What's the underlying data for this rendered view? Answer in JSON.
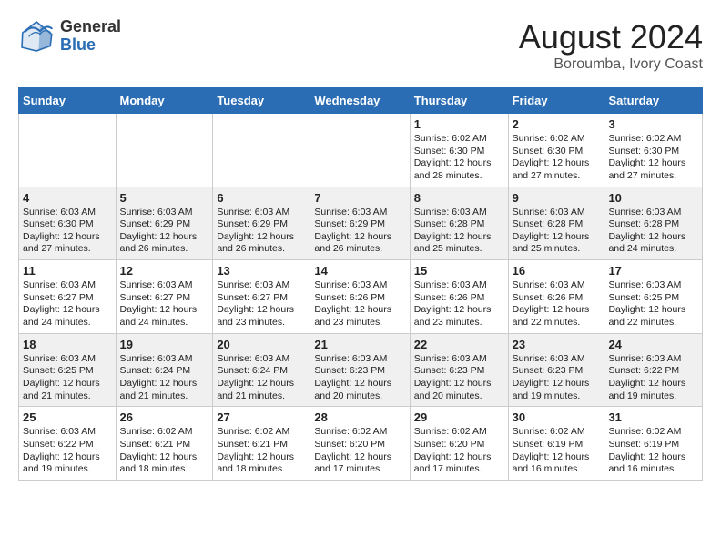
{
  "header": {
    "logo_general": "General",
    "logo_blue": "Blue",
    "month_year": "August 2024",
    "location": "Boroumba, Ivory Coast"
  },
  "days_of_week": [
    "Sunday",
    "Monday",
    "Tuesday",
    "Wednesday",
    "Thursday",
    "Friday",
    "Saturday"
  ],
  "weeks": [
    [
      {
        "day": "",
        "info": ""
      },
      {
        "day": "",
        "info": ""
      },
      {
        "day": "",
        "info": ""
      },
      {
        "day": "",
        "info": ""
      },
      {
        "day": "1",
        "info": "Sunrise: 6:02 AM\nSunset: 6:30 PM\nDaylight: 12 hours and 28 minutes."
      },
      {
        "day": "2",
        "info": "Sunrise: 6:02 AM\nSunset: 6:30 PM\nDaylight: 12 hours and 27 minutes."
      },
      {
        "day": "3",
        "info": "Sunrise: 6:02 AM\nSunset: 6:30 PM\nDaylight: 12 hours and 27 minutes."
      }
    ],
    [
      {
        "day": "4",
        "info": "Sunrise: 6:03 AM\nSunset: 6:30 PM\nDaylight: 12 hours and 27 minutes."
      },
      {
        "day": "5",
        "info": "Sunrise: 6:03 AM\nSunset: 6:29 PM\nDaylight: 12 hours and 26 minutes."
      },
      {
        "day": "6",
        "info": "Sunrise: 6:03 AM\nSunset: 6:29 PM\nDaylight: 12 hours and 26 minutes."
      },
      {
        "day": "7",
        "info": "Sunrise: 6:03 AM\nSunset: 6:29 PM\nDaylight: 12 hours and 26 minutes."
      },
      {
        "day": "8",
        "info": "Sunrise: 6:03 AM\nSunset: 6:28 PM\nDaylight: 12 hours and 25 minutes."
      },
      {
        "day": "9",
        "info": "Sunrise: 6:03 AM\nSunset: 6:28 PM\nDaylight: 12 hours and 25 minutes."
      },
      {
        "day": "10",
        "info": "Sunrise: 6:03 AM\nSunset: 6:28 PM\nDaylight: 12 hours and 24 minutes."
      }
    ],
    [
      {
        "day": "11",
        "info": "Sunrise: 6:03 AM\nSunset: 6:27 PM\nDaylight: 12 hours and 24 minutes."
      },
      {
        "day": "12",
        "info": "Sunrise: 6:03 AM\nSunset: 6:27 PM\nDaylight: 12 hours and 24 minutes."
      },
      {
        "day": "13",
        "info": "Sunrise: 6:03 AM\nSunset: 6:27 PM\nDaylight: 12 hours and 23 minutes."
      },
      {
        "day": "14",
        "info": "Sunrise: 6:03 AM\nSunset: 6:26 PM\nDaylight: 12 hours and 23 minutes."
      },
      {
        "day": "15",
        "info": "Sunrise: 6:03 AM\nSunset: 6:26 PM\nDaylight: 12 hours and 23 minutes."
      },
      {
        "day": "16",
        "info": "Sunrise: 6:03 AM\nSunset: 6:26 PM\nDaylight: 12 hours and 22 minutes."
      },
      {
        "day": "17",
        "info": "Sunrise: 6:03 AM\nSunset: 6:25 PM\nDaylight: 12 hours and 22 minutes."
      }
    ],
    [
      {
        "day": "18",
        "info": "Sunrise: 6:03 AM\nSunset: 6:25 PM\nDaylight: 12 hours and 21 minutes."
      },
      {
        "day": "19",
        "info": "Sunrise: 6:03 AM\nSunset: 6:24 PM\nDaylight: 12 hours and 21 minutes."
      },
      {
        "day": "20",
        "info": "Sunrise: 6:03 AM\nSunset: 6:24 PM\nDaylight: 12 hours and 21 minutes."
      },
      {
        "day": "21",
        "info": "Sunrise: 6:03 AM\nSunset: 6:23 PM\nDaylight: 12 hours and 20 minutes."
      },
      {
        "day": "22",
        "info": "Sunrise: 6:03 AM\nSunset: 6:23 PM\nDaylight: 12 hours and 20 minutes."
      },
      {
        "day": "23",
        "info": "Sunrise: 6:03 AM\nSunset: 6:23 PM\nDaylight: 12 hours and 19 minutes."
      },
      {
        "day": "24",
        "info": "Sunrise: 6:03 AM\nSunset: 6:22 PM\nDaylight: 12 hours and 19 minutes."
      }
    ],
    [
      {
        "day": "25",
        "info": "Sunrise: 6:03 AM\nSunset: 6:22 PM\nDaylight: 12 hours and 19 minutes."
      },
      {
        "day": "26",
        "info": "Sunrise: 6:02 AM\nSunset: 6:21 PM\nDaylight: 12 hours and 18 minutes."
      },
      {
        "day": "27",
        "info": "Sunrise: 6:02 AM\nSunset: 6:21 PM\nDaylight: 12 hours and 18 minutes."
      },
      {
        "day": "28",
        "info": "Sunrise: 6:02 AM\nSunset: 6:20 PM\nDaylight: 12 hours and 17 minutes."
      },
      {
        "day": "29",
        "info": "Sunrise: 6:02 AM\nSunset: 6:20 PM\nDaylight: 12 hours and 17 minutes."
      },
      {
        "day": "30",
        "info": "Sunrise: 6:02 AM\nSunset: 6:19 PM\nDaylight: 12 hours and 16 minutes."
      },
      {
        "day": "31",
        "info": "Sunrise: 6:02 AM\nSunset: 6:19 PM\nDaylight: 12 hours and 16 minutes."
      }
    ]
  ]
}
